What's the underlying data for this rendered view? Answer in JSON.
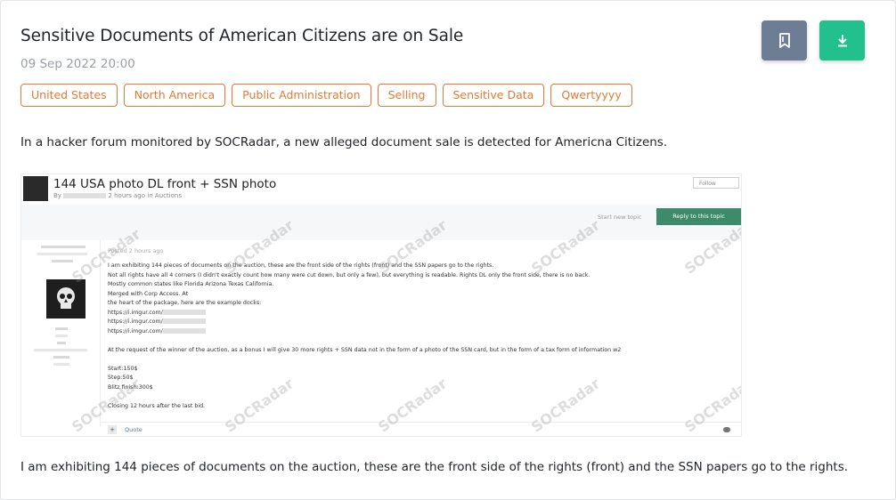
{
  "post": {
    "title": "Sensitive Documents of American Citizens are on Sale",
    "date": "09 Sep 2022 20:00",
    "tags": [
      "United States",
      "North America",
      "Public Administration",
      "Selling",
      "Sensitive Data",
      "Qwertyyyy"
    ],
    "intro": "In a hacker forum monitored by SOCRadar, a new alleged document sale is detected for Americna Citizens.",
    "body_text": "I am exhibiting 144 pieces of documents on the auction, these are the front side of the rights (front) and the SSN papers go to the rights."
  },
  "actions": {
    "bookmark_icon": "bookmark-icon",
    "download_icon": "download-icon",
    "bookmark_color": "#6d7d93",
    "download_color": "#21c08c"
  },
  "colors": {
    "tag_accent": "#e07b39",
    "reply_button": "#3d8b6a"
  },
  "screenshot": {
    "thread_title": "144 USA photo DL front + SSN photo",
    "byline": "By",
    "byline_time": "2 hours ago in Auctions",
    "follow": "Follow",
    "start_new_topic": "Start new topic",
    "reply_button": "Reply to this topic",
    "posted": "Posted 2 hours ago",
    "post_lines": [
      "I am exhibiting 144 pieces of documents on the auction, these are the front side of the rights (front) and the SSN papers go to the rights.",
      "Not all rights have all 4 corners (I didn't exactly count how many were cut down, but only a few), but everything is readable. Rights DL only the front side, there is no back.",
      "Mostly common states like Florida Arizona Texas California.",
      "Merged with Corp Access. At",
      "the heart of the package, here are the example docks:",
      "https://i.imgur.com/",
      "https://i.imgur.com/",
      "https://i.imgur.com/",
      "",
      "At the request of the winner of the auction, as a bonus I will give 30 more rights + SSN data not in the form of a photo of the SSN card, but in the form of a tax form of information w2",
      "",
      "Start:150$",
      "Step:50$",
      "Blitz finish:300$",
      "",
      "Closing 12 hours after the last bid."
    ],
    "quote": "Quote",
    "watermark": "SOCRadar"
  }
}
